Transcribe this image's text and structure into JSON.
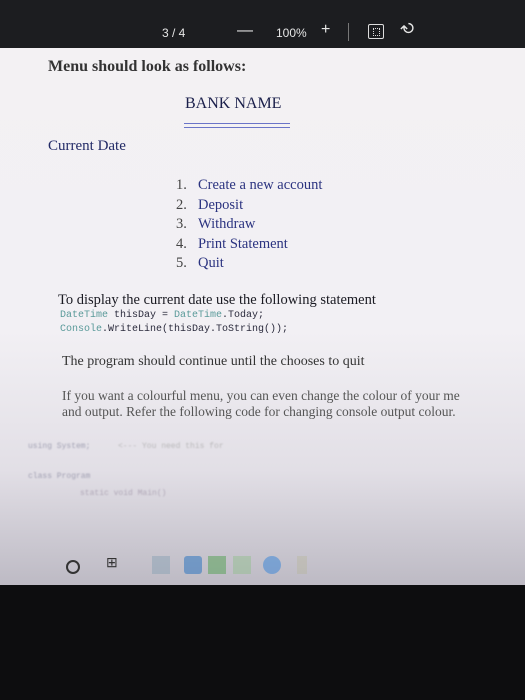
{
  "toolbar": {
    "page_indicator": "3 / 4",
    "zoom_out": "—",
    "zoom_level": "100%",
    "zoom_in": "+",
    "rotate_icon": "rotate-icon"
  },
  "doc": {
    "cut_heading": "Menu should look as follows:",
    "bank_name": "BANK NAME",
    "current_date": "Current Date",
    "menu": [
      {
        "num": "1.",
        "label": "Create a new account"
      },
      {
        "num": "2.",
        "label": "Deposit"
      },
      {
        "num": "3.",
        "label": "Withdraw"
      },
      {
        "num": "4.",
        "label": "Print Statement"
      },
      {
        "num": "5.",
        "label": "Quit"
      }
    ],
    "date_instruction": "To display the current date use the following statement",
    "code_line1_type": "DateTime",
    "code_line1_var": " thisDay = ",
    "code_line1_call": "DateTime",
    "code_line1_end": ".Today;",
    "code_line2_obj": "Console",
    "code_line2_end": ".WriteLine(thisDay.ToString());",
    "continue_text": "The program should continue until the chooses to quit",
    "colour_text_1": "If you want a colourful menu, you can even change the colour of your me",
    "colour_text_2": "and output. Refer the following code for changing console output colour.",
    "blur_code_1": "using System;",
    "blur_code_2": "<--- You need this for",
    "blur_code_3": "class Program",
    "blur_code_4": "static void Main()"
  },
  "taskbar": {
    "task_view": "⊞"
  },
  "colors": {
    "menu_text": "#2b3380",
    "code_keyword": "#5a9a9a",
    "toolbar_bg": "#1c1d20"
  }
}
